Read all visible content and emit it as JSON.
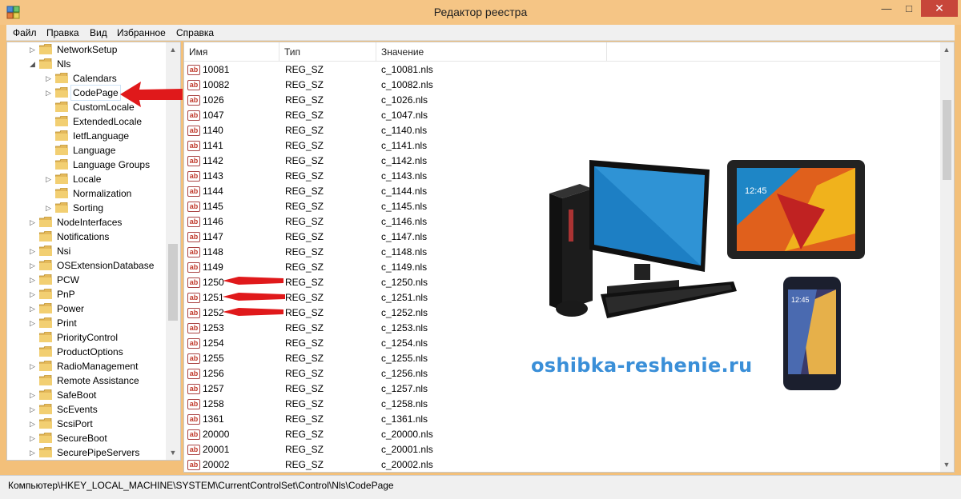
{
  "window": {
    "title": "Редактор реестра",
    "minimize_glyph": "—",
    "maximize_glyph": "□",
    "close_glyph": "✕"
  },
  "menu": [
    {
      "label": "Файл"
    },
    {
      "label": "Правка"
    },
    {
      "label": "Вид"
    },
    {
      "label": "Избранное"
    },
    {
      "label": "Справка"
    }
  ],
  "tree": {
    "items": [
      {
        "label": "NetworkSetup",
        "expander": "▷",
        "level": 1
      },
      {
        "label": "Nls",
        "expander": "◢",
        "level": 1
      },
      {
        "label": "Calendars",
        "expander": "▷",
        "level": 2
      },
      {
        "label": "CodePage",
        "expander": "▷",
        "level": 2,
        "selected": true
      },
      {
        "label": "CustomLocale",
        "expander": "",
        "level": 2
      },
      {
        "label": "ExtendedLocale",
        "expander": "",
        "level": 2
      },
      {
        "label": "IetfLanguage",
        "expander": "",
        "level": 2
      },
      {
        "label": "Language",
        "expander": "",
        "level": 2
      },
      {
        "label": "Language Groups",
        "expander": "",
        "level": 2
      },
      {
        "label": "Locale",
        "expander": "▷",
        "level": 2
      },
      {
        "label": "Normalization",
        "expander": "",
        "level": 2
      },
      {
        "label": "Sorting",
        "expander": "▷",
        "level": 2
      },
      {
        "label": "NodeInterfaces",
        "expander": "▷",
        "level": 1
      },
      {
        "label": "Notifications",
        "expander": "",
        "level": 1
      },
      {
        "label": "Nsi",
        "expander": "▷",
        "level": 1
      },
      {
        "label": "OSExtensionDatabase",
        "expander": "▷",
        "level": 1
      },
      {
        "label": "PCW",
        "expander": "▷",
        "level": 1
      },
      {
        "label": "PnP",
        "expander": "▷",
        "level": 1
      },
      {
        "label": "Power",
        "expander": "▷",
        "level": 1
      },
      {
        "label": "Print",
        "expander": "▷",
        "level": 1
      },
      {
        "label": "PriorityControl",
        "expander": "",
        "level": 1
      },
      {
        "label": "ProductOptions",
        "expander": "",
        "level": 1
      },
      {
        "label": "RadioManagement",
        "expander": "▷",
        "level": 1
      },
      {
        "label": "Remote Assistance",
        "expander": "",
        "level": 1
      },
      {
        "label": "SafeBoot",
        "expander": "▷",
        "level": 1
      },
      {
        "label": "ScEvents",
        "expander": "▷",
        "level": 1
      },
      {
        "label": "ScsiPort",
        "expander": "▷",
        "level": 1
      },
      {
        "label": "SecureBoot",
        "expander": "▷",
        "level": 1
      },
      {
        "label": "SecurePipeServers",
        "expander": "▷",
        "level": 1
      }
    ]
  },
  "list": {
    "columns": [
      "Имя",
      "Тип",
      "Значение"
    ],
    "icon_text": "ab",
    "rows": [
      {
        "name": "10081",
        "type": "REG_SZ",
        "value": "c_10081.nls"
      },
      {
        "name": "10082",
        "type": "REG_SZ",
        "value": "c_10082.nls"
      },
      {
        "name": "1026",
        "type": "REG_SZ",
        "value": "c_1026.nls"
      },
      {
        "name": "1047",
        "type": "REG_SZ",
        "value": "c_1047.nls"
      },
      {
        "name": "1140",
        "type": "REG_SZ",
        "value": "c_1140.nls"
      },
      {
        "name": "1141",
        "type": "REG_SZ",
        "value": "c_1141.nls"
      },
      {
        "name": "1142",
        "type": "REG_SZ",
        "value": "c_1142.nls"
      },
      {
        "name": "1143",
        "type": "REG_SZ",
        "value": "c_1143.nls"
      },
      {
        "name": "1144",
        "type": "REG_SZ",
        "value": "c_1144.nls"
      },
      {
        "name": "1145",
        "type": "REG_SZ",
        "value": "c_1145.nls"
      },
      {
        "name": "1146",
        "type": "REG_SZ",
        "value": "c_1146.nls"
      },
      {
        "name": "1147",
        "type": "REG_SZ",
        "value": "c_1147.nls"
      },
      {
        "name": "1148",
        "type": "REG_SZ",
        "value": "c_1148.nls"
      },
      {
        "name": "1149",
        "type": "REG_SZ",
        "value": "c_1149.nls"
      },
      {
        "name": "1250",
        "type": "REG_SZ",
        "value": "c_1250.nls"
      },
      {
        "name": "1251",
        "type": "REG_SZ",
        "value": "c_1251.nls"
      },
      {
        "name": "1252",
        "type": "REG_SZ",
        "value": "c_1252.nls"
      },
      {
        "name": "1253",
        "type": "REG_SZ",
        "value": "c_1253.nls"
      },
      {
        "name": "1254",
        "type": "REG_SZ",
        "value": "c_1254.nls"
      },
      {
        "name": "1255",
        "type": "REG_SZ",
        "value": "c_1255.nls"
      },
      {
        "name": "1256",
        "type": "REG_SZ",
        "value": "c_1256.nls"
      },
      {
        "name": "1257",
        "type": "REG_SZ",
        "value": "c_1257.nls"
      },
      {
        "name": "1258",
        "type": "REG_SZ",
        "value": "c_1258.nls"
      },
      {
        "name": "1361",
        "type": "REG_SZ",
        "value": "c_1361.nls"
      },
      {
        "name": "20000",
        "type": "REG_SZ",
        "value": "c_20000.nls"
      },
      {
        "name": "20001",
        "type": "REG_SZ",
        "value": "c_20001.nls"
      },
      {
        "name": "20002",
        "type": "REG_SZ",
        "value": "c_20002.nls"
      }
    ]
  },
  "status_path": "Компьютер\\HKEY_LOCAL_MACHINE\\SYSTEM\\CurrentControlSet\\Control\\Nls\\CodePage",
  "watermark": "oshibka-reshenie.ru",
  "colors": {
    "title_bar": "#f5c585",
    "close_button": "#c7463a",
    "annotation_arrow": "#e0191b",
    "watermark": "#3a8fd8"
  }
}
